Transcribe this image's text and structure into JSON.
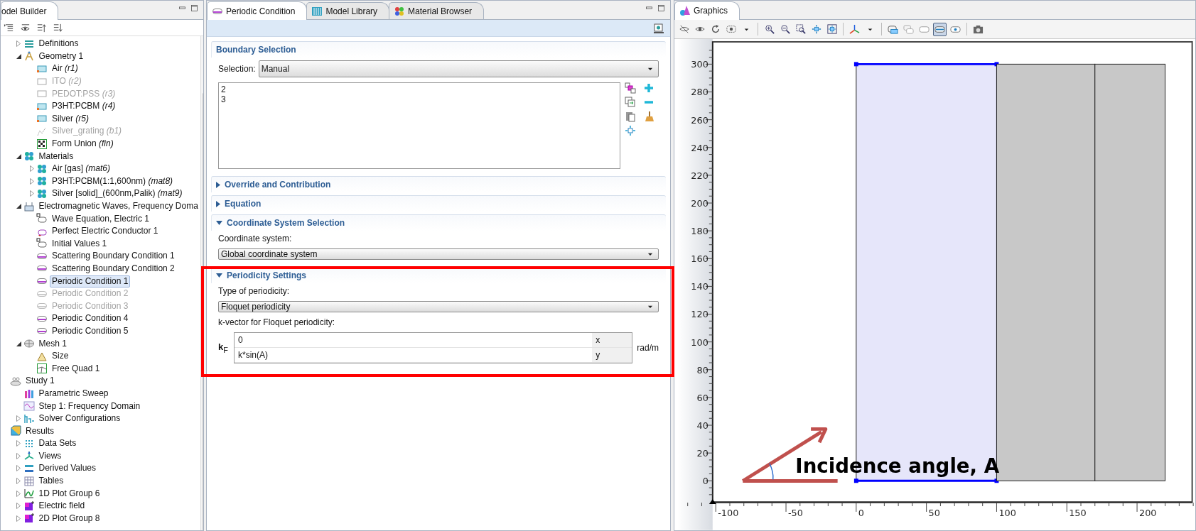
{
  "model_builder": {
    "title": "odel Builder"
  },
  "tree": {
    "component_items": [
      {
        "label": "Definitions",
        "kind": "definitions",
        "expanded": false,
        "disabled": false,
        "selected": false
      },
      {
        "label": "Geometry 1",
        "kind": "geometry",
        "expanded": true,
        "disabled": false,
        "selected": false,
        "children": [
          {
            "label": "Air *(r1)*",
            "kind": "rect",
            "disabled": false,
            "selected": false
          },
          {
            "label": "ITO *(r2)*",
            "kind": "rect",
            "disabled": true,
            "selected": false
          },
          {
            "label": "PEDOT:PSS *(r3)*",
            "kind": "rect",
            "disabled": true,
            "selected": false
          },
          {
            "label": "P3HT:PCBM *(r4)*",
            "kind": "rect",
            "disabled": false,
            "selected": false
          },
          {
            "label": "Silver *(r5)*",
            "kind": "rect",
            "disabled": false,
            "selected": false
          },
          {
            "label": "Silver_grating *(b1)*",
            "kind": "polygon",
            "disabled": true,
            "selected": false
          },
          {
            "label": "Form Union *(fin)*",
            "kind": "union",
            "disabled": false,
            "selected": false
          }
        ]
      },
      {
        "label": "Materials",
        "kind": "material",
        "expanded": true,
        "disabled": false,
        "selected": false,
        "children": [
          {
            "label": "Air [gas] *(mat6)*",
            "kind": "material",
            "expanded": false,
            "disabled": false,
            "selected": false
          },
          {
            "label": "P3HT:PCBM(1:1,600nm) *(mat8)*",
            "kind": "material",
            "expanded": false,
            "disabled": false,
            "selected": false
          },
          {
            "label": "Silver [solid]_(600nm,Palik) *(mat9)*",
            "kind": "material",
            "expanded": false,
            "disabled": false,
            "selected": false
          }
        ]
      },
      {
        "label": "Electromagnetic Waves, Frequency Doma",
        "kind": "physics",
        "expanded": true,
        "disabled": false,
        "selected": false,
        "children": [
          {
            "label": "Wave Equation, Electric 1",
            "kind": "domain",
            "disabled": false,
            "selected": false
          },
          {
            "label": "Perfect Electric Conductor 1",
            "kind": "pec",
            "disabled": false,
            "selected": false
          },
          {
            "label": "Initial Values 1",
            "kind": "domain",
            "disabled": false,
            "selected": false
          },
          {
            "label": "Scattering Boundary Condition 1",
            "kind": "boundary",
            "disabled": false,
            "selected": false
          },
          {
            "label": "Scattering Boundary Condition 2",
            "kind": "boundary",
            "disabled": false,
            "selected": false
          },
          {
            "label": "Periodic Condition 1",
            "kind": "boundary",
            "disabled": false,
            "selected": true
          },
          {
            "label": "Periodic Condition 2",
            "kind": "boundary",
            "disabled": true,
            "selected": false
          },
          {
            "label": "Periodic Condition 3",
            "kind": "boundary",
            "disabled": true,
            "selected": false
          },
          {
            "label": "Periodic Condition 4",
            "kind": "boundary",
            "disabled": false,
            "selected": false
          },
          {
            "label": "Periodic Condition 5",
            "kind": "boundary",
            "disabled": false,
            "selected": false
          }
        ]
      },
      {
        "label": "Mesh 1",
        "kind": "mesh",
        "expanded": true,
        "disabled": false,
        "selected": false,
        "children": [
          {
            "label": "Size",
            "kind": "size",
            "disabled": false,
            "selected": false
          },
          {
            "label": "Free Quad 1",
            "kind": "quad",
            "disabled": false,
            "selected": false
          }
        ]
      }
    ],
    "root_items": [
      {
        "label": "Study 1",
        "kind": "study",
        "disabled": false,
        "selected": false,
        "children": [
          {
            "label": "Parametric Sweep",
            "kind": "sweep",
            "disabled": false,
            "selected": false
          },
          {
            "label": "Step 1: Frequency Domain",
            "kind": "step",
            "disabled": false,
            "selected": false
          },
          {
            "label": "Solver Configurations",
            "kind": "solver",
            "expanded": false,
            "disabled": false,
            "selected": false
          }
        ]
      },
      {
        "label": "Results",
        "kind": "results",
        "disabled": false,
        "selected": false,
        "children": [
          {
            "label": "Data Sets",
            "kind": "datasets",
            "expanded": false,
            "disabled": false,
            "selected": false
          },
          {
            "label": "Views",
            "kind": "views",
            "expanded": false,
            "disabled": false,
            "selected": false
          },
          {
            "label": "Derived Values",
            "kind": "derived",
            "expanded": false,
            "disabled": false,
            "selected": false
          },
          {
            "label": "Tables",
            "kind": "tables",
            "expanded": false,
            "disabled": false,
            "selected": false
          },
          {
            "label": "1D Plot Group 6",
            "kind": "plot1d",
            "expanded": false,
            "disabled": false,
            "selected": false
          },
          {
            "label": "Electric field",
            "kind": "plot2d",
            "expanded": false,
            "disabled": false,
            "selected": false
          },
          {
            "label": "2D Plot Group 8",
            "kind": "plot2d",
            "expanded": false,
            "disabled": false,
            "selected": false
          }
        ]
      }
    ]
  },
  "settings": {
    "tabs": [
      {
        "label": "Periodic Condition",
        "kind": "boundary",
        "selected": true
      },
      {
        "label": "Model Library",
        "kind": "library",
        "selected": false
      },
      {
        "label": "Material Browser",
        "kind": "material",
        "selected": false
      }
    ],
    "sections": [
      {
        "title": "Boundary Selection",
        "kind": "boundary",
        "selection_label": "Selection:",
        "selection": "Manual",
        "entries": [
          "2",
          "3"
        ]
      },
      {
        "title": "Override and Contribution",
        "kind": "plain",
        "expanded": false
      },
      {
        "title": "Equation",
        "kind": "plain",
        "expanded": false
      },
      {
        "title": "Coordinate System Selection",
        "kind": "coordinate",
        "expanded": true,
        "label": "Coordinate system:",
        "value": "Global coordinate system"
      },
      {
        "title": "Periodicity Settings",
        "kind": "periodicity",
        "expanded": true,
        "type_label": "Type of periodicity:",
        "type": "Floquet periodicity",
        "vector_label": "k-vector for Floquet periodicity:",
        "symbol": "**k**$_{F}$",
        "rows": [
          {
            "value": "0",
            "axis": "x"
          },
          {
            "value": "k*sin(A)",
            "axis": "y"
          }
        ],
        "unit": "rad/m"
      }
    ]
  },
  "graphics": {
    "title": "Graphics",
    "toolbar": [
      [
        {
          "kind": "hide",
          "selected": false
        },
        {
          "kind": "show",
          "selected": false
        },
        {
          "kind": "reset",
          "selected": false
        },
        {
          "kind": "view",
          "selected": false
        },
        {
          "kind": "caret",
          "selected": false
        }
      ],
      [
        {
          "kind": "zoom-in",
          "selected": false
        },
        {
          "kind": "zoom-out",
          "selected": false
        },
        {
          "kind": "zoom-box",
          "selected": false
        },
        {
          "kind": "zoom-sel",
          "selected": false
        },
        {
          "kind": "zoom-fit",
          "selected": false
        }
      ],
      [
        {
          "kind": "axes",
          "selected": false
        },
        {
          "kind": "caret",
          "selected": false
        }
      ],
      [
        {
          "kind": "sel-a",
          "selected": false
        },
        {
          "kind": "sel-b",
          "selected": false
        },
        {
          "kind": "sel-c",
          "selected": false
        },
        {
          "kind": "sel-d",
          "selected": true
        },
        {
          "kind": "sel-e",
          "selected": false
        }
      ],
      [
        {
          "kind": "camera",
          "selected": false
        }
      ]
    ],
    "y_ticks": [
      "300",
      "280",
      "260",
      "240",
      "220",
      "200",
      "180",
      "160",
      "140",
      "120",
      "100",
      "80",
      "60",
      "40",
      "20",
      "0"
    ],
    "x_ticks": [
      "-100",
      "-50",
      "0",
      "50",
      "100",
      "150",
      "200"
    ],
    "annotation": "Incidence angle, A"
  }
}
